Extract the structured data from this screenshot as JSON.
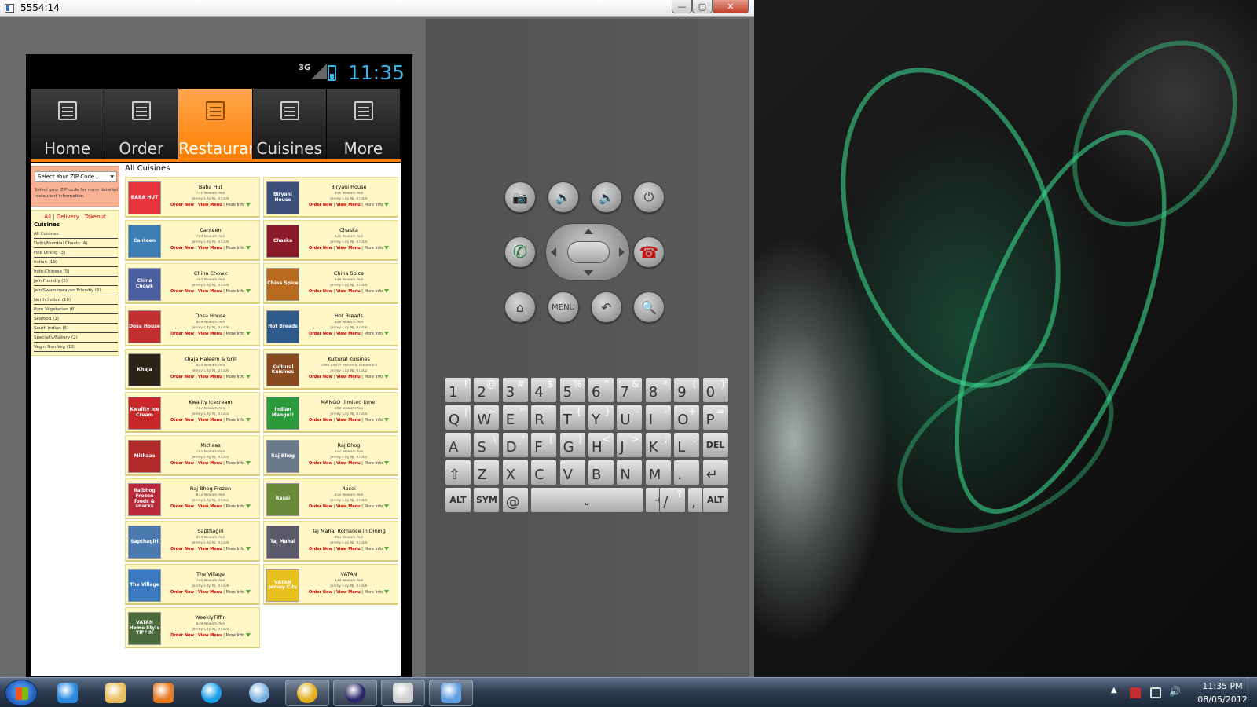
{
  "window": {
    "title": "5554:14",
    "minimize_glyph": "—",
    "maximize_glyph": "▢",
    "close_glyph": "✕"
  },
  "phone": {
    "network_type": "3G",
    "clock": "11:35",
    "accent_color": "#39b5e6"
  },
  "tabs": [
    {
      "label": "Home",
      "icon": "list-icon",
      "active": false
    },
    {
      "label": "Order",
      "icon": "card-icon",
      "active": false
    },
    {
      "label": "Restaurants",
      "icon": "menu-icon",
      "active": true
    },
    {
      "label": "Cuisines",
      "icon": "fork-knife-icon",
      "active": false
    },
    {
      "label": "More",
      "icon": "list-icon",
      "active": false
    }
  ],
  "sidebar": {
    "zip_placeholder": "Select Your ZIP Code...",
    "zip_hint": "Select your ZIP code for more detailed restaurant information.",
    "filters": [
      "All",
      "Delivery",
      "Takeout"
    ],
    "cuisines_heading": "Cuisines",
    "cuisines": [
      "All Cuisines",
      "Delhi/Mumbai Chaats (4)",
      "Fine Dining (3)",
      "Indian (19)",
      "Indo-Chinese (5)",
      "Jain Friendly (5)",
      "Jain/Swaminarayan Friendly (6)",
      "North Indian (10)",
      "Pure Vegetarian (8)",
      "Seafood (2)",
      "South Indian (5)",
      "Specialty/Bakery (2)",
      "Veg n Non-Veg (13)"
    ]
  },
  "grid": {
    "heading": "All Cuisines",
    "link_order": "Order Now",
    "link_menu": "View Menu",
    "link_info": "More Info",
    "separator": " | ",
    "restaurants": [
      {
        "name": "Baba Hut",
        "addr1": "771 Newark Ave",
        "addr2": "Jersey City NJ, 07306",
        "logo_text": "BABA HUT",
        "logo_color": "#e8323c"
      },
      {
        "name": "Biryani House",
        "addr1": "806 Newark Ave",
        "addr2": "Jersey City NJ, 07306",
        "logo_text": "Biryani House",
        "logo_color": "#3a4f7a"
      },
      {
        "name": "Canteen",
        "addr1": "789 Newark Ave",
        "addr2": "Jersey City NJ, 07306",
        "logo_text": "Canteen",
        "logo_color": "#3d7fb5"
      },
      {
        "name": "Chaska",
        "addr1": "826 Newark Ave",
        "addr2": "Jersey City NJ, 07306",
        "logo_text": "Chaska",
        "logo_color": "#8a1a2a"
      },
      {
        "name": "China Chowk",
        "addr1": "785 Newark Ave",
        "addr2": "Jersey City NJ, 07306",
        "logo_text": "China Chowk",
        "logo_color": "#4a5ea0"
      },
      {
        "name": "China Spice",
        "addr1": "839 Newark Ave",
        "addr2": "Jersey City NJ, 07306",
        "logo_text": "China Spice",
        "logo_color": "#b86a1e"
      },
      {
        "name": "Dosa House",
        "addr1": "809 Newark Ave",
        "addr2": "Jersey City NJ, 07306",
        "logo_text": "Dosa House",
        "logo_color": "#c03030"
      },
      {
        "name": "Hot Breads",
        "addr1": "808 Newark Ave",
        "addr2": "Jersey City NJ, 07306",
        "logo_text": "Hot Breads",
        "logo_color": "#2d5a8a"
      },
      {
        "name": "Khaja Haleem & Grill",
        "addr1": "824 Newark Ave",
        "addr2": "Jersey City NJ, 07306",
        "logo_text": "Khaja",
        "logo_color": "#2a2418"
      },
      {
        "name": "Kultural Kuisines",
        "addr1": "2986 John F Kennedy Boulevard",
        "addr2": "Jersey City NJ, 07302",
        "logo_text": "Kultural Kuisines",
        "logo_color": "#8a4a20"
      },
      {
        "name": "Kwality Icecream",
        "addr1": "787 Newark Ave",
        "addr2": "Jersey City NJ, 07302",
        "logo_text": "Kwality Ice Cream",
        "logo_color": "#c8282a"
      },
      {
        "name": "MANGO (limited time)",
        "addr1": "808 Newark Ave",
        "addr2": "Jersey City NJ, 07306",
        "logo_text": "Indian Mango!!",
        "logo_color": "#2a9a3a"
      },
      {
        "name": "Mithaas",
        "addr1": "785 Newark Ave",
        "addr2": "Jersey City NJ, 07302",
        "logo_text": "Mithaas",
        "logo_color": "#b02a2a"
      },
      {
        "name": "Raj Bhog",
        "addr1": "812 Newark Ave",
        "addr2": "Jersey City NJ, 07302",
        "logo_text": "Raj Bhog",
        "logo_color": "#6a7a8a"
      },
      {
        "name": "Raj Bhog Frozen",
        "addr1": "812 Newark Ave",
        "addr2": "Jersey City NJ, 07302",
        "logo_text": "Rajbhog Frozen foods & snacks",
        "logo_color": "#b82838"
      },
      {
        "name": "Rasoi",
        "addr1": "853 Newark Ave",
        "addr2": "Jersey City NJ, 07306",
        "logo_text": "Rasoi",
        "logo_color": "#6a8a3a"
      },
      {
        "name": "Sapthagiri",
        "addr1": "804 Newark Ave",
        "addr2": "Jersey City NJ, 07306",
        "logo_text": "Sapthagiri",
        "logo_color": "#4a7ab0"
      },
      {
        "name": "Taj Mahal Romance in Dining",
        "addr1": "803 Newark Ave",
        "addr2": "Jersey City NJ, 07306",
        "logo_text": "Taj Mahal",
        "logo_color": "#5a5a6a"
      },
      {
        "name": "The Village",
        "addr1": "795 Newark Ave",
        "addr2": "Jersey City NJ, 07306",
        "logo_text": "The Village",
        "logo_color": "#3a7ac0"
      },
      {
        "name": "VATAN",
        "addr1": "839 Newark Ave",
        "addr2": "Jersey City NJ, 07306",
        "logo_text": "VATAN Jersey City",
        "logo_color": "#e8c020"
      },
      {
        "name": "WeeklyTiffin",
        "addr1": "839 Newark Ave",
        "addr2": "Jersey City NJ, 07302",
        "logo_text": "VATAN Home Style TIFFIN",
        "logo_color": "#4a6a3a"
      }
    ]
  },
  "controls": {
    "row1": [
      {
        "name": "camera-button",
        "glyph": "📷"
      },
      {
        "name": "volume-down-button",
        "glyph": "🔉"
      },
      {
        "name": "volume-up-button",
        "glyph": "🔊"
      },
      {
        "name": "power-button",
        "glyph": "⏻"
      }
    ],
    "call_glyph": "✆",
    "end_call_glyph": "☎",
    "row3": [
      {
        "name": "home-button",
        "glyph": "⌂"
      },
      {
        "name": "menu-button",
        "glyph": "MENU"
      },
      {
        "name": "back-button",
        "glyph": "↶"
      },
      {
        "name": "search-button",
        "glyph": "🔍"
      }
    ]
  },
  "keyboard": {
    "row1": [
      [
        "1",
        "!"
      ],
      [
        "2",
        "@"
      ],
      [
        "3",
        "#"
      ],
      [
        "4",
        "$"
      ],
      [
        "5",
        "%"
      ],
      [
        "6",
        "^"
      ],
      [
        "7",
        "&"
      ],
      [
        "8",
        "*"
      ],
      [
        "9",
        "("
      ],
      [
        "0",
        ")"
      ]
    ],
    "row2": [
      [
        "Q",
        "|"
      ],
      [
        "W",
        "~"
      ],
      [
        "E",
        "\""
      ],
      [
        "R",
        "`"
      ],
      [
        "T",
        "{"
      ],
      [
        "Y",
        "}"
      ],
      [
        "U",
        "-"
      ],
      [
        "I",
        "-"
      ],
      [
        "O",
        "+"
      ],
      [
        "P",
        "="
      ]
    ],
    "row3": [
      [
        "A",
        ""
      ],
      [
        "S",
        "\\"
      ],
      [
        "D",
        "'"
      ],
      [
        "F",
        "["
      ],
      [
        "G",
        "]"
      ],
      [
        "H",
        "<"
      ],
      [
        "J",
        ">"
      ],
      [
        "K",
        ";"
      ],
      [
        "L",
        ":"
      ],
      [
        "DEL",
        "⌫"
      ]
    ],
    "row4": [
      [
        "⇧",
        ""
      ],
      [
        "Z",
        ""
      ],
      [
        "X",
        ""
      ],
      [
        "C",
        ""
      ],
      [
        "V",
        ""
      ],
      [
        "B",
        ""
      ],
      [
        "N",
        ""
      ],
      [
        "M",
        ""
      ],
      [
        ".",
        ""
      ],
      [
        "↵",
        ""
      ]
    ],
    "row5_left": [
      "ALT",
      "SYM",
      "@"
    ],
    "space_glyph": "⎵",
    "tab_glyph": "⇥",
    "row5_right": [
      [
        "/",
        "?"
      ],
      [
        ",",
        ""
      ],
      [
        "ALT",
        ""
      ]
    ]
  },
  "taskbar": {
    "items": [
      {
        "name": "internet-explorer",
        "color": "#2a8ae0",
        "open": false
      },
      {
        "name": "windows-explorer",
        "color": "#e8c060",
        "open": false
      },
      {
        "name": "media-player",
        "color": "#e87a20",
        "open": false
      },
      {
        "name": "skype",
        "color": "#1aa0e8",
        "open": false
      },
      {
        "name": "safari",
        "color": "#7ab0e0",
        "open": false
      },
      {
        "name": "chrome",
        "color": "#e0b020",
        "open": true
      },
      {
        "name": "eclipse",
        "color": "#2a2a6a",
        "open": true
      },
      {
        "name": "emulator",
        "color": "#d0d0d0",
        "open": true
      },
      {
        "name": "paint",
        "color": "#60a0e0",
        "open": true
      }
    ],
    "time": "11:35 PM",
    "date": "08/05/2012"
  }
}
